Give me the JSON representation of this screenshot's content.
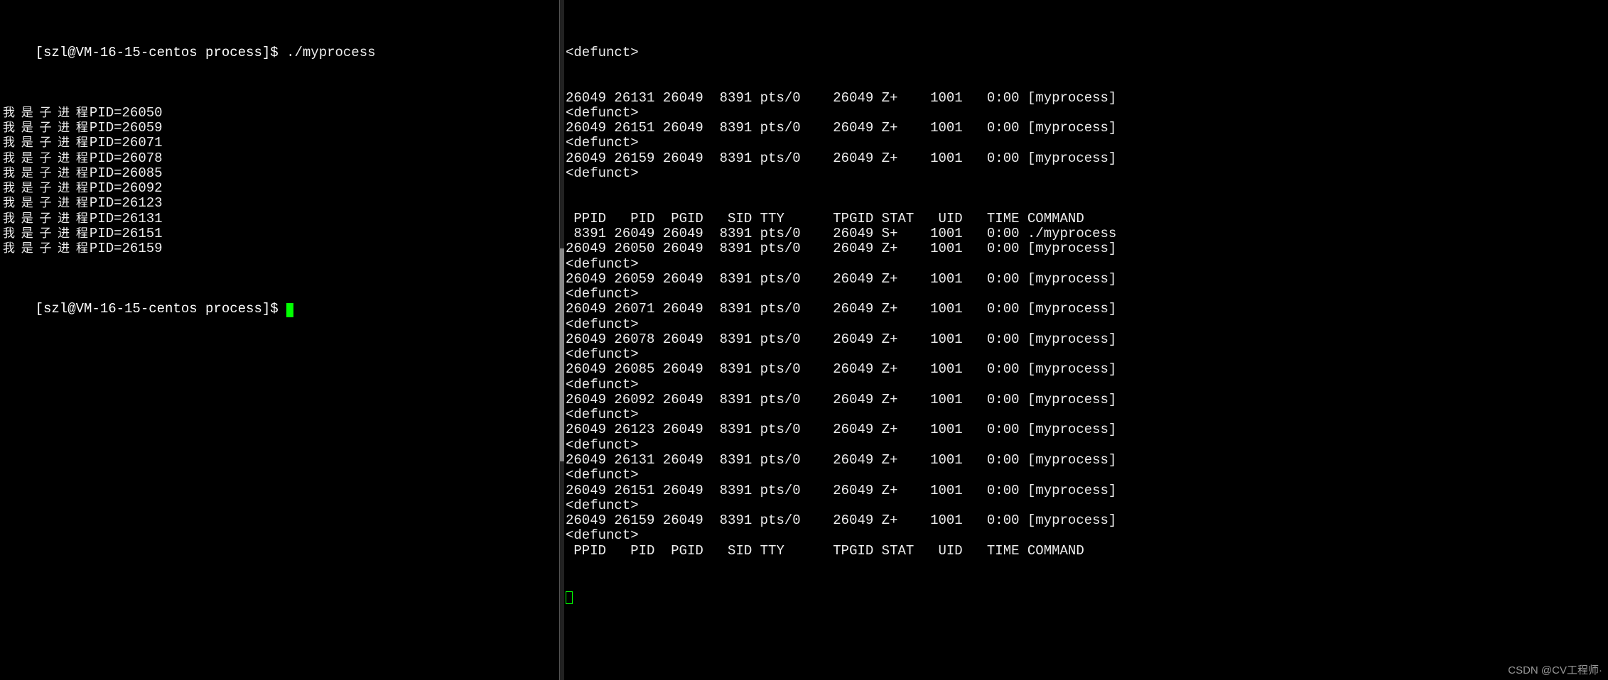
{
  "left": {
    "prompt1_bracket_open": "[",
    "prompt1_user": "szl@VM-16-15-centos process",
    "prompt1_bracket_close": "]$ ",
    "cmd1": "./myprocess",
    "child_prefix": "我 是 子 进 程",
    "child_pids": [
      "PID=26050",
      "PID=26059",
      "PID=26071",
      "PID=26078",
      "PID=26085",
      "PID=26092",
      "PID=26123",
      "PID=26131",
      "PID=26151",
      "PID=26159"
    ],
    "prompt2_bracket_open": "[",
    "prompt2_user": "szl@VM-16-15-centos process",
    "prompt2_bracket_close": "]$ "
  },
  "right": {
    "defunct": "<defunct>",
    "header": " PPID   PID  PGID   SID TTY      TPGID STAT   UID   TIME COMMAND",
    "block1": [
      "26049 26131 26049  8391 pts/0    26049 Z+    1001   0:00 [myprocess]",
      "<defunct>",
      "26049 26151 26049  8391 pts/0    26049 Z+    1001   0:00 [myprocess]",
      "<defunct>",
      "26049 26159 26049  8391 pts/0    26049 Z+    1001   0:00 [myprocess]",
      "<defunct>"
    ],
    "block2": [
      " PPID   PID  PGID   SID TTY      TPGID STAT   UID   TIME COMMAND",
      " 8391 26049 26049  8391 pts/0    26049 S+    1001   0:00 ./myprocess",
      "26049 26050 26049  8391 pts/0    26049 Z+    1001   0:00 [myprocess]",
      "<defunct>",
      "26049 26059 26049  8391 pts/0    26049 Z+    1001   0:00 [myprocess]",
      "<defunct>",
      "26049 26071 26049  8391 pts/0    26049 Z+    1001   0:00 [myprocess]",
      "<defunct>",
      "26049 26078 26049  8391 pts/0    26049 Z+    1001   0:00 [myprocess]",
      "<defunct>",
      "26049 26085 26049  8391 pts/0    26049 Z+    1001   0:00 [myprocess]",
      "<defunct>",
      "26049 26092 26049  8391 pts/0    26049 Z+    1001   0:00 [myprocess]",
      "<defunct>",
      "26049 26123 26049  8391 pts/0    26049 Z+    1001   0:00 [myprocess]",
      "<defunct>",
      "26049 26131 26049  8391 pts/0    26049 Z+    1001   0:00 [myprocess]",
      "<defunct>",
      "26049 26151 26049  8391 pts/0    26049 Z+    1001   0:00 [myprocess]",
      "<defunct>",
      "26049 26159 26049  8391 pts/0    26049 Z+    1001   0:00 [myprocess]",
      "<defunct>",
      " PPID   PID  PGID   SID TTY      TPGID STAT   UID   TIME COMMAND"
    ]
  },
  "watermark": "CSDN @CV工程师·"
}
